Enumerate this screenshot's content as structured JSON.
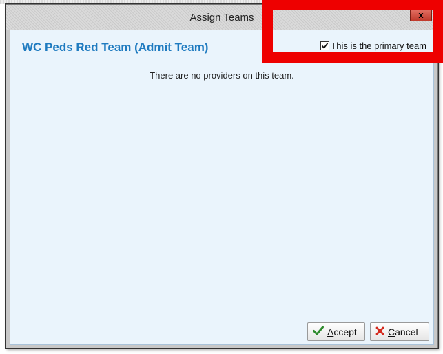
{
  "dialog": {
    "title": "Assign Teams",
    "close_label": "x"
  },
  "team": {
    "name": "WC Peds Red Team (Admit Team)",
    "primary_label": "This is the primary team",
    "primary_checked": true,
    "empty_message": "There are no providers on this team."
  },
  "buttons": {
    "accept_label": "Accept",
    "cancel_label": "Cancel"
  },
  "icons": {
    "accept": "checkmark-icon",
    "cancel": "x-mark-icon",
    "checkbox": "checkbox-checked-icon"
  },
  "colors": {
    "accent": "#1f7bc0",
    "content_bg": "#eaf4fc",
    "highlight": "#ee0000",
    "accept_icon": "#2e8b2e",
    "cancel_icon": "#d42a1e"
  }
}
